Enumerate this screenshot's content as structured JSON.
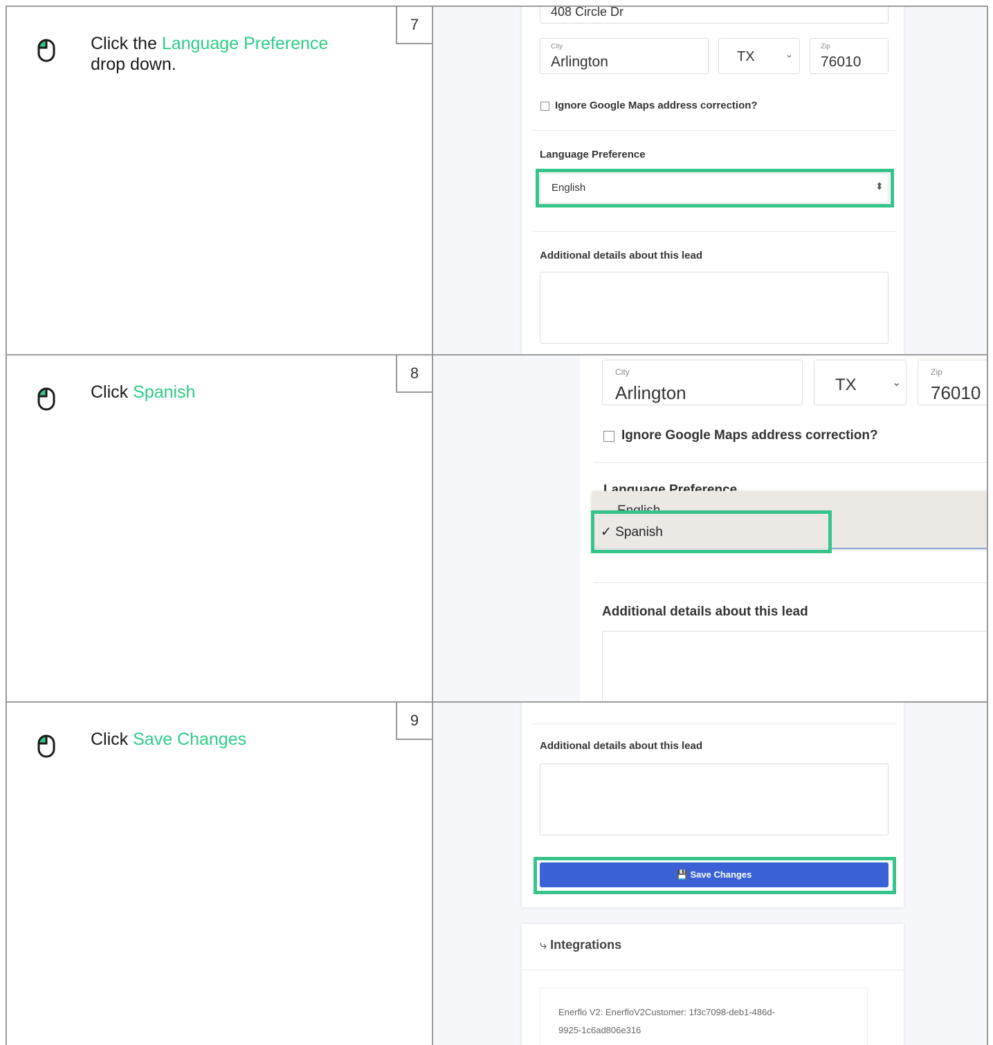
{
  "steps": [
    {
      "number": "7",
      "instruction_prefix": "Click the ",
      "instruction_highlight": "Language Preference",
      "instruction_suffix": " drop down.",
      "screen": {
        "address": "408 Circle Dr",
        "city_label": "City",
        "city_value": "Arlington",
        "state_value": "TX",
        "zip_label": "Zip",
        "zip_value": "76010",
        "ignore_checkbox_label": "Ignore Google Maps address correction?",
        "language_label": "Language Preference",
        "language_value": "English",
        "details_label": "Additional details about this lead"
      }
    },
    {
      "number": "8",
      "instruction_prefix": "Click ",
      "instruction_highlight": "Spanish",
      "instruction_suffix": "",
      "screen": {
        "city_label": "City",
        "city_value": "Arlington",
        "state_value": "TX",
        "zip_label": "Zip",
        "zip_value": "76010",
        "ignore_checkbox_label": "Ignore Google Maps address correction?",
        "language_label": "Language Preference",
        "options": [
          "English",
          "Spanish"
        ],
        "selected_mark": "✓",
        "details_label": "Additional details about this lead"
      }
    },
    {
      "number": "9",
      "instruction_prefix": "Click ",
      "instruction_highlight": "Save Changes",
      "instruction_suffix": "",
      "screen": {
        "details_label": "Additional details about this lead",
        "save_button": "Save Changes",
        "integrations_title": "Integrations",
        "integration_line1": "Enerflo V2: EnerfloV2Customer: 1f3c7098-deb1-486d-",
        "integration_line2": "9925-1c6ad806e316"
      }
    }
  ],
  "colors": {
    "highlight": "#2ecc85",
    "box": "#36c48a",
    "button": "#3a62d6"
  }
}
